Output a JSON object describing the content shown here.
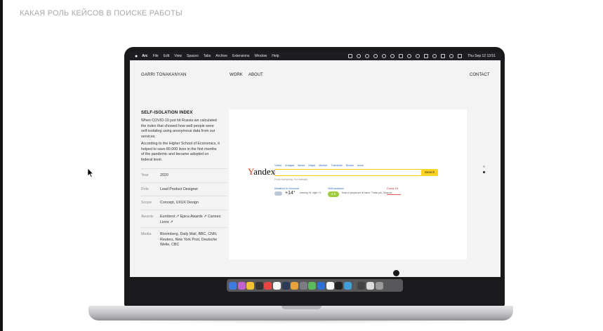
{
  "slide": {
    "title": "КАКАЯ РОЛЬ КЕЙСОВ В ПОИСКЕ РАБОТЫ"
  },
  "menubar": {
    "app": "Arc",
    "items": [
      "File",
      "Edit",
      "View",
      "Spaces",
      "Tabs",
      "Archive",
      "Extensions",
      "Window",
      "Help"
    ],
    "clock": "Thu Sep 12  13:51"
  },
  "site": {
    "name": "GARRI TONAKANYAN",
    "nav": {
      "work": "WORK",
      "about": "ABOUT",
      "contact": "CONTACT"
    },
    "project": {
      "title": "SELF-ISOLATION INDEX",
      "desc1": "When COVID-19 just hit Russia we calculated the index that showed how well people were self-isolating using anonymous data from our services.",
      "desc2": "According to the Higher School of Economics, it helped to save 80.000 lives in the first months of the pandemic and became adopted on federal level.",
      "meta": {
        "year_label": "Year",
        "year": "2020",
        "role_label": "Role",
        "role": "Lead Product Designer",
        "scope_label": "Scope",
        "scope": "Concept, UI/UX Design",
        "awards_label": "Awards",
        "awards": "Eurobest ↗  Epica Awards ↗ Cannes Lions ↗",
        "media_label": "Media",
        "media": "Bloomberg, Daily Mail, BBC, CNN, Reuters, New York Post, Deutsche Welle, CBC"
      }
    }
  },
  "yandex": {
    "logo_first": "Y",
    "logo_rest": "andex",
    "nav": [
      "Video",
      "Images",
      "News",
      "Maps",
      "Market",
      "Translate",
      "Books",
      "more"
    ],
    "search_button": "Search",
    "hint": "Finds everything. For example, ",
    "weather_title": "Weather in Moscow",
    "temp": "+14°",
    "weather_detail": "evening +6, night +3",
    "iso_title": "Self-isolation",
    "iso_value": "2.5",
    "iso_detail": "Most of people are at home. Thank you, Moscow",
    "covid_title": "Covid-19"
  },
  "dock": {
    "colors": [
      "#3d7be0",
      "#c061cf",
      "#f1c232",
      "#333333",
      "#e94545",
      "#f6f6f6",
      "#2b3a55",
      "#e8a23a",
      "#7c7c84",
      "#5cb85c",
      "#2f6fd3",
      "#fafafa",
      "#222222",
      "#3f9fd8",
      "#444444",
      "#dcdcdc",
      "#9b9b9b"
    ],
    "separator_after": 14
  }
}
